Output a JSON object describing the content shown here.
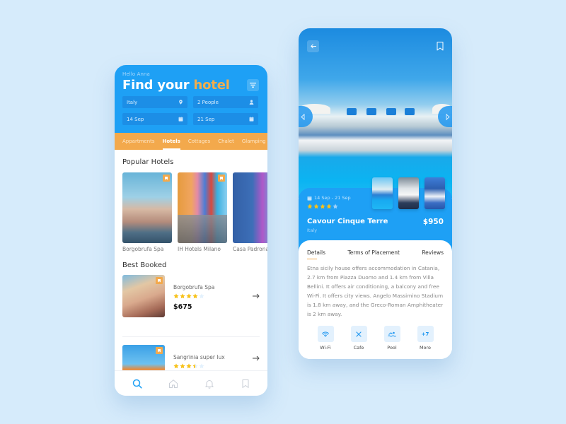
{
  "colors": {
    "primary_blue": "#1ea0f5",
    "accent_orange": "#f3a94c",
    "background": "#d6ebfb",
    "star_filled": "#f7c21a",
    "star_empty": "#e3f1fd"
  },
  "search_screen": {
    "greeting": "Hello Anna",
    "title_main": "Find your",
    "title_accent": "hotel",
    "filter_icon": "filter-icon",
    "fields": {
      "location": {
        "value": "Italy",
        "icon": "location-pin-icon"
      },
      "guests": {
        "value": "2 People",
        "icon": "person-icon"
      },
      "check_in": {
        "value": "14 Sep",
        "icon": "calendar-icon"
      },
      "check_out": {
        "value": "21 Sep",
        "icon": "calendar-icon"
      }
    },
    "categories": [
      {
        "label": "Appartments",
        "active": false
      },
      {
        "label": "Hotels",
        "active": true
      },
      {
        "label": "Cottages",
        "active": false
      },
      {
        "label": "Chalet",
        "active": false
      },
      {
        "label": "Glamping",
        "active": false
      }
    ],
    "popular": {
      "title": "Popular Hotels",
      "items": [
        {
          "name": "Borgobrufa Spa"
        },
        {
          "name": "IH Hotels Milano"
        },
        {
          "name": "Casa Padronale"
        }
      ]
    },
    "best_booked": {
      "title": "Best Booked",
      "items": [
        {
          "name": "Borgobrufa Spa",
          "rating": 4,
          "max_rating": 5,
          "price": "$675"
        },
        {
          "name": "Sangrinia super lux",
          "rating": 3.5,
          "max_rating": 5,
          "price": ""
        }
      ]
    },
    "bottom_nav": [
      {
        "name": "search",
        "icon": "search-icon",
        "active": true
      },
      {
        "name": "home",
        "icon": "home-icon",
        "active": false
      },
      {
        "name": "notifications",
        "icon": "bell-icon",
        "active": false
      },
      {
        "name": "saved",
        "icon": "bookmark-icon",
        "active": false
      }
    ]
  },
  "detail_screen": {
    "back_icon": "arrow-left-icon",
    "bookmark_icon": "bookmark-icon",
    "dates": "14 Sep - 21 Sep",
    "rating": 4,
    "max_rating": 5,
    "hotel_name": "Cavour Cinque Terre",
    "country": "Italy",
    "price": "$950",
    "tabs": [
      {
        "label": "Details",
        "active": true
      },
      {
        "label": "Terms of Placement",
        "active": false
      },
      {
        "label": "Reviews",
        "active": false
      }
    ],
    "description": "Etna sicily house offers accommodation in Catania, 2.7 km from Piazza Duomo and 1.4 km from Villa Bellini. It offers air conditioning, a balcony and free Wi-Fi. It offers city views. Angelo Massimino Stadium is 1.8 km away, and the Greco-Roman Amphitheater is 2 km away.",
    "amenities": [
      {
        "label": "Wi-Fi",
        "icon": "wifi-icon"
      },
      {
        "label": "Cafe",
        "icon": "cutlery-icon"
      },
      {
        "label": "Pool",
        "icon": "pool-icon"
      },
      {
        "label": "More",
        "icon_text": "+7"
      }
    ]
  }
}
